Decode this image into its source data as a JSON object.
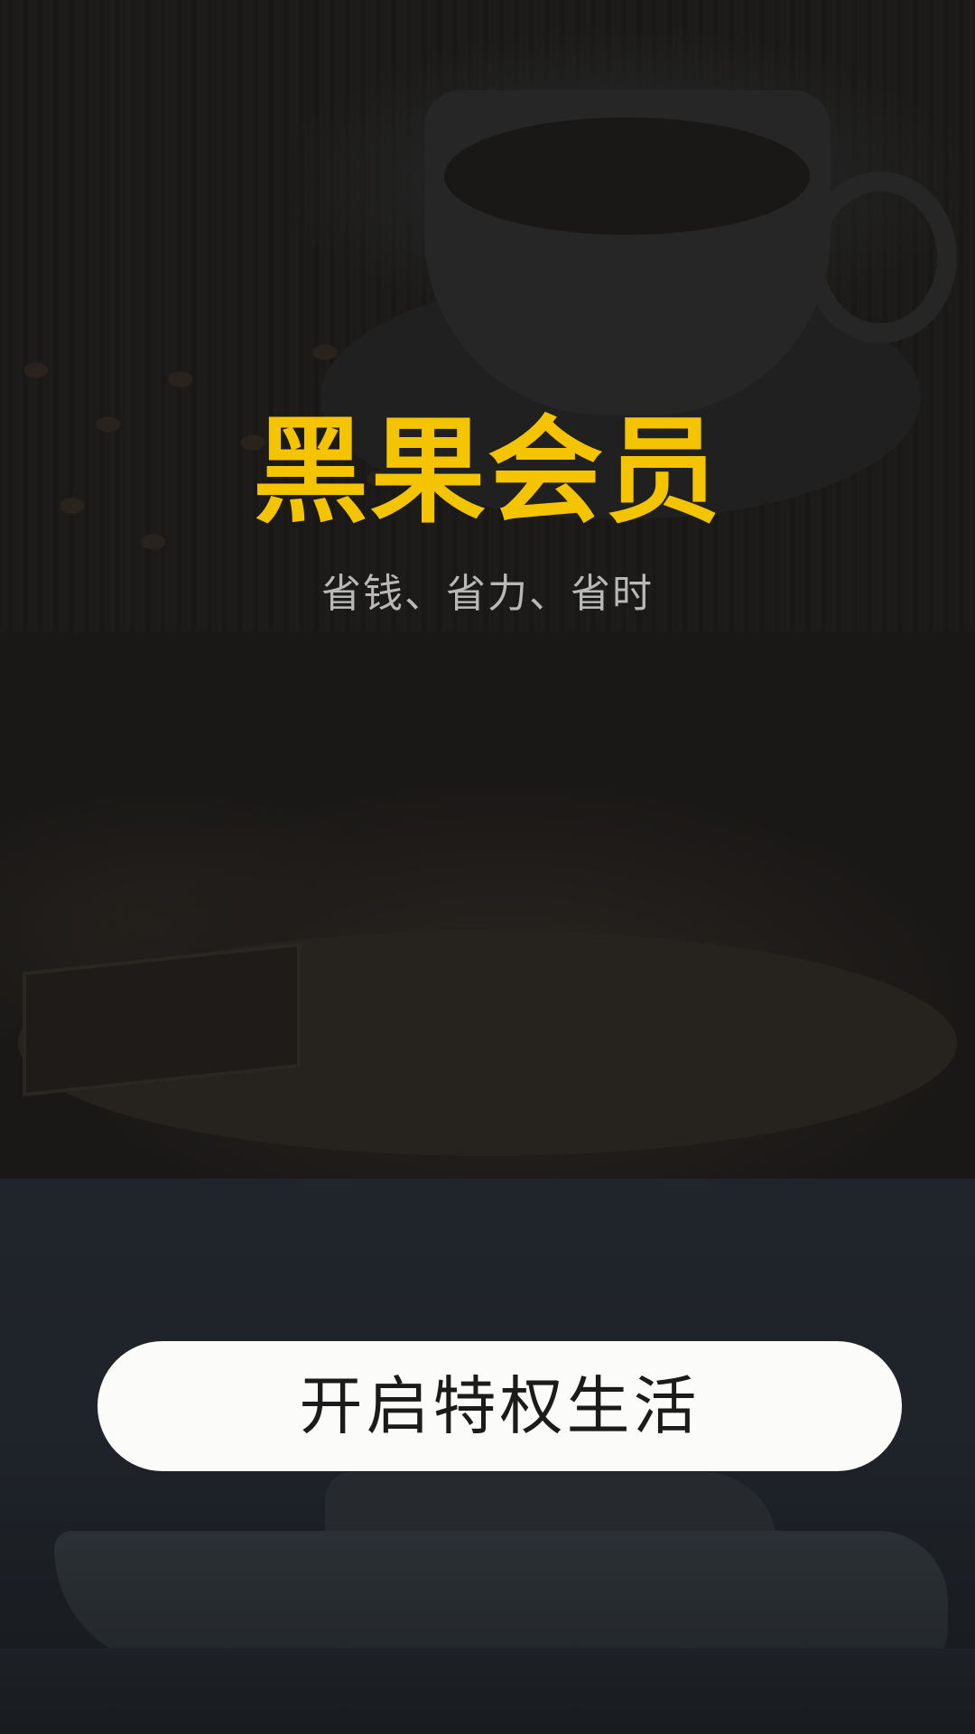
{
  "app": {
    "title": "黑果会员",
    "subtitle": "省钱、省力、省时"
  },
  "actions": {
    "start_label": "开启特权生活"
  },
  "colors": {
    "title": "#f5c400",
    "subtitle": "#b8b8b8",
    "button_bg": "#fbfbf9",
    "button_text": "#1b1b1b"
  },
  "background": {
    "panels": [
      "coffee-cup-photo",
      "seafood-platter-photo",
      "yacht-photo"
    ]
  }
}
